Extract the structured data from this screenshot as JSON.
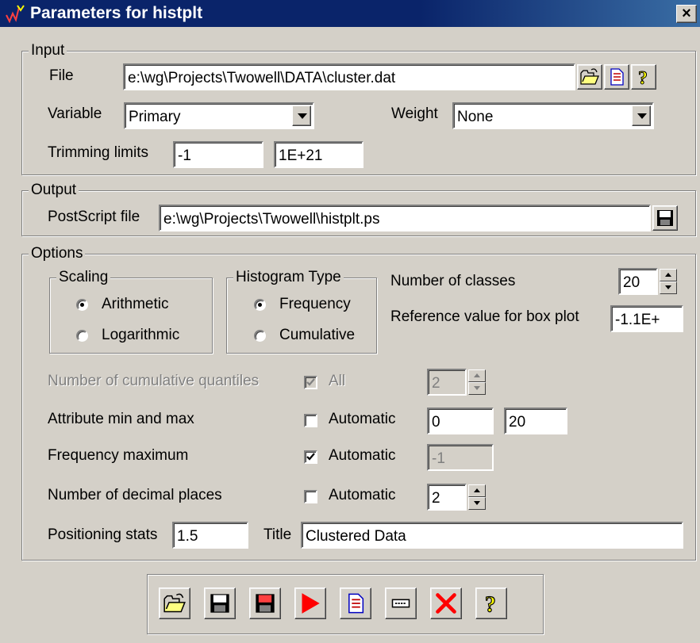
{
  "window": {
    "title": "Parameters for histplt",
    "close_glyph": "×"
  },
  "input": {
    "group_label": "Input",
    "file_label": "File",
    "file_value": "e:\\wg\\Projects\\Twowell\\DATA\\cluster.dat",
    "variable_label": "Variable",
    "variable_value": "Primary",
    "weight_label": "Weight",
    "weight_value": "None",
    "trimming_label": "Trimming limits",
    "trim_min": "-1",
    "trim_max": "1E+21"
  },
  "output": {
    "group_label": "Output",
    "postscript_label": "PostScript file",
    "postscript_value": "e:\\wg\\Projects\\Twowell\\histplt.ps"
  },
  "options": {
    "group_label": "Options",
    "scaling": {
      "label": "Scaling",
      "arithmetic": "Arithmetic",
      "logarithmic": "Logarithmic",
      "selected": "Arithmetic"
    },
    "histogram_type": {
      "label": "Histogram Type",
      "frequency": "Frequency",
      "cumulative": "Cumulative",
      "selected": "Frequency"
    },
    "num_classes_label": "Number of classes",
    "num_classes_value": "20",
    "ref_value_label": "Reference value for box plot",
    "ref_value": "-1.1E+",
    "cum_quantiles_label": "Number of cumulative quantiles",
    "cum_quantiles_all_label": "All",
    "cum_quantiles_all_checked": true,
    "cum_quantiles_value": "2",
    "attr_minmax_label": "Attribute min and max",
    "attr_auto_label": "Automatic",
    "attr_auto_checked": false,
    "attr_min": "0",
    "attr_max": "20",
    "freq_max_label": "Frequency maximum",
    "freq_auto_label": "Automatic",
    "freq_auto_checked": true,
    "freq_max_value": "-1",
    "decimals_label": "Number of decimal places",
    "decimals_auto_label": "Automatic",
    "decimals_auto_checked": false,
    "decimals_value": "2",
    "positioning_label": "Positioning stats",
    "positioning_value": "1.5",
    "title_label": "Title",
    "title_value": "Clustered Data"
  },
  "toolbar": {
    "buttons": [
      "open-folder-icon",
      "save-icon",
      "save-as-icon",
      "run-icon",
      "view-file-icon",
      "parameters-icon",
      "cancel-icon",
      "help-icon"
    ]
  },
  "colors": {
    "face": "#d4d0c8",
    "title_bar": "#0a246a",
    "run": "#ff0000",
    "cancel": "#ff0000",
    "help": "#ffff00"
  }
}
